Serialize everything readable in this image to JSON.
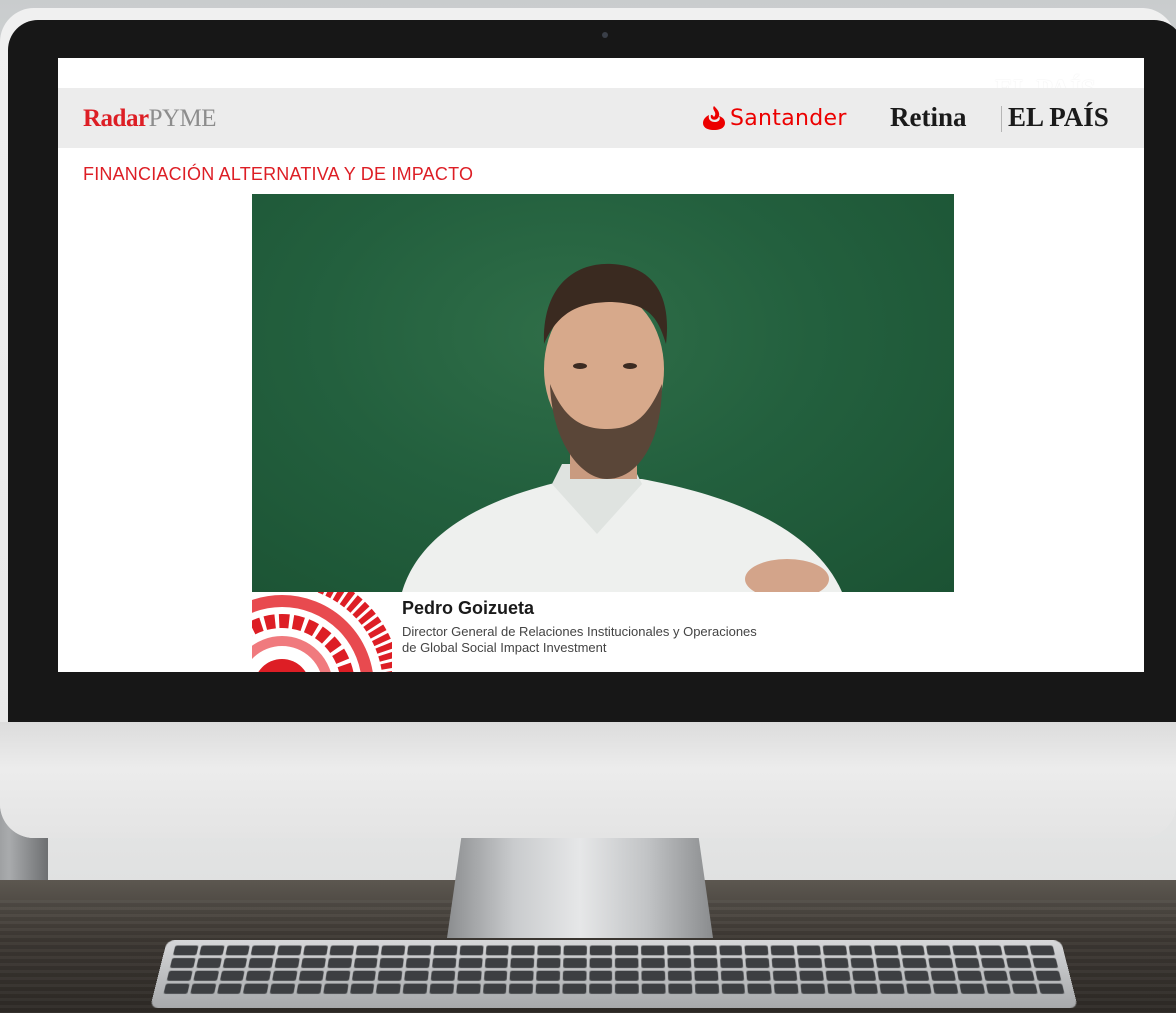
{
  "header": {
    "brand_radar": "Radar",
    "brand_pyme": "PYME",
    "sponsor": "Santander",
    "partner_retina": "Retina",
    "partner_elpais": "EL PAÍS",
    "watermark": "EL PAÍS"
  },
  "section": {
    "title": "FINANCIACIÓN ALTERNATIVA Y DE IMPACTO"
  },
  "speaker": {
    "name": "Pedro Goizueta",
    "role_line1": "Director General de Relaciones Institucionales y Operaciones",
    "role_line2": "de Global Social Impact Investment"
  },
  "colors": {
    "brand_red": "#dd1e25",
    "santander_red": "#ec0000",
    "video_background": "#23603e"
  },
  "icons": {
    "santander_logo": "santander-flame-icon",
    "lower_third_graphic": "red-ring-graphic"
  }
}
